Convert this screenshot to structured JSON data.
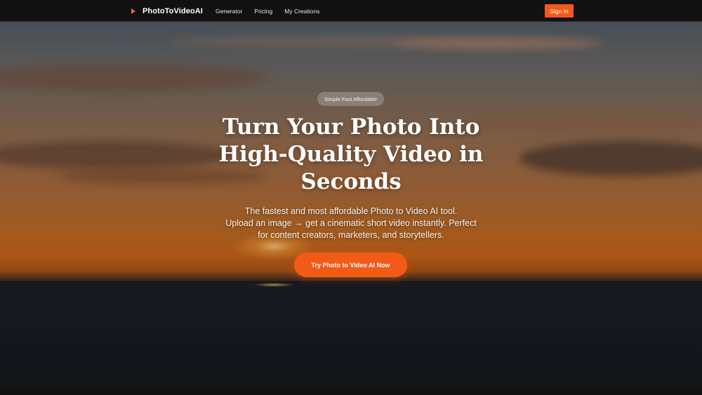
{
  "nav": {
    "brand": "PhotoToVideoAI",
    "links": [
      "Generator",
      "Pricing",
      "My Creations"
    ],
    "signin_label": "Sign In"
  },
  "hero": {
    "badge": "Simple Fast Affordable",
    "title_lines": [
      "Turn Your Photo Into",
      "High-Quality Video in",
      "Seconds"
    ],
    "subtitle_lines": [
      "The fastest and most affordable Photo to Video AI tool.",
      "Upload an image → get a cinematic short video instantly. Perfect",
      "for content creators, marketers, and storytellers."
    ],
    "cta_label": "Try Photo to Video AI Now"
  },
  "colors": {
    "accent": "#f25a17",
    "nav_bg": "#111111",
    "brand_icon": "#f26722"
  },
  "icons": {
    "brand": "play-icon"
  }
}
